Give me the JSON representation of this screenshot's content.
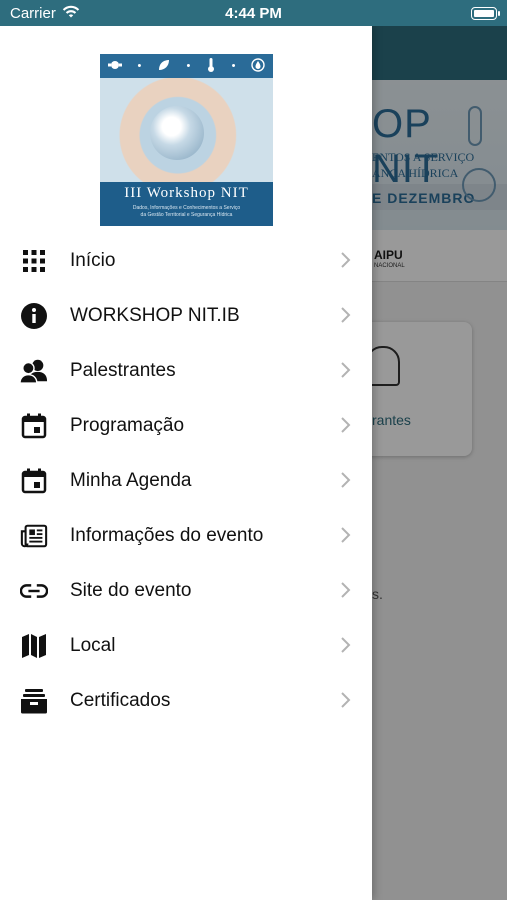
{
  "status_bar": {
    "carrier": "Carrier",
    "time": "4:44 PM",
    "icons": [
      "wifi-icon",
      "battery-icon"
    ]
  },
  "background": {
    "banner_title": "OP NIT",
    "banner_line1": "ENTOS A SERVIÇO",
    "banner_line2": "ANÇA HÍDRICA",
    "banner_date": "E DEZEMBRO",
    "partner_logo": "AIPU",
    "partner_logo_sub": "NACIONAL",
    "card_label": "rantes",
    "body_text_fragment": "s."
  },
  "drawer": {
    "logo": {
      "title": "III Workshop NIT",
      "subtitle_line1": "Dados, Informações e Conhecimentos a Serviço",
      "subtitle_line2": "da Gestão Territorial e Segurança Hídrica",
      "top_icons": [
        "satellite-icon",
        "leaf-icon",
        "thermometer-icon",
        "water-drop-icon"
      ]
    },
    "items": [
      {
        "label": "Início",
        "icon": "grid-icon"
      },
      {
        "label": "WORKSHOP NIT.IB",
        "icon": "info-icon"
      },
      {
        "label": "Palestrantes",
        "icon": "people-icon"
      },
      {
        "label": "Programação",
        "icon": "calendar-icon"
      },
      {
        "label": "Minha Agenda",
        "icon": "calendar-icon"
      },
      {
        "label": "Informações do evento",
        "icon": "newspaper-icon"
      },
      {
        "label": "Site do evento",
        "icon": "link-icon"
      },
      {
        "label": "Local",
        "icon": "map-icon"
      },
      {
        "label": "Certificados",
        "icon": "archive-icon"
      }
    ]
  },
  "colors": {
    "accent": "#2e6d7e",
    "drawer_bg": "#ffffff",
    "text": "#111111",
    "chevron": "#b3b3b3"
  }
}
